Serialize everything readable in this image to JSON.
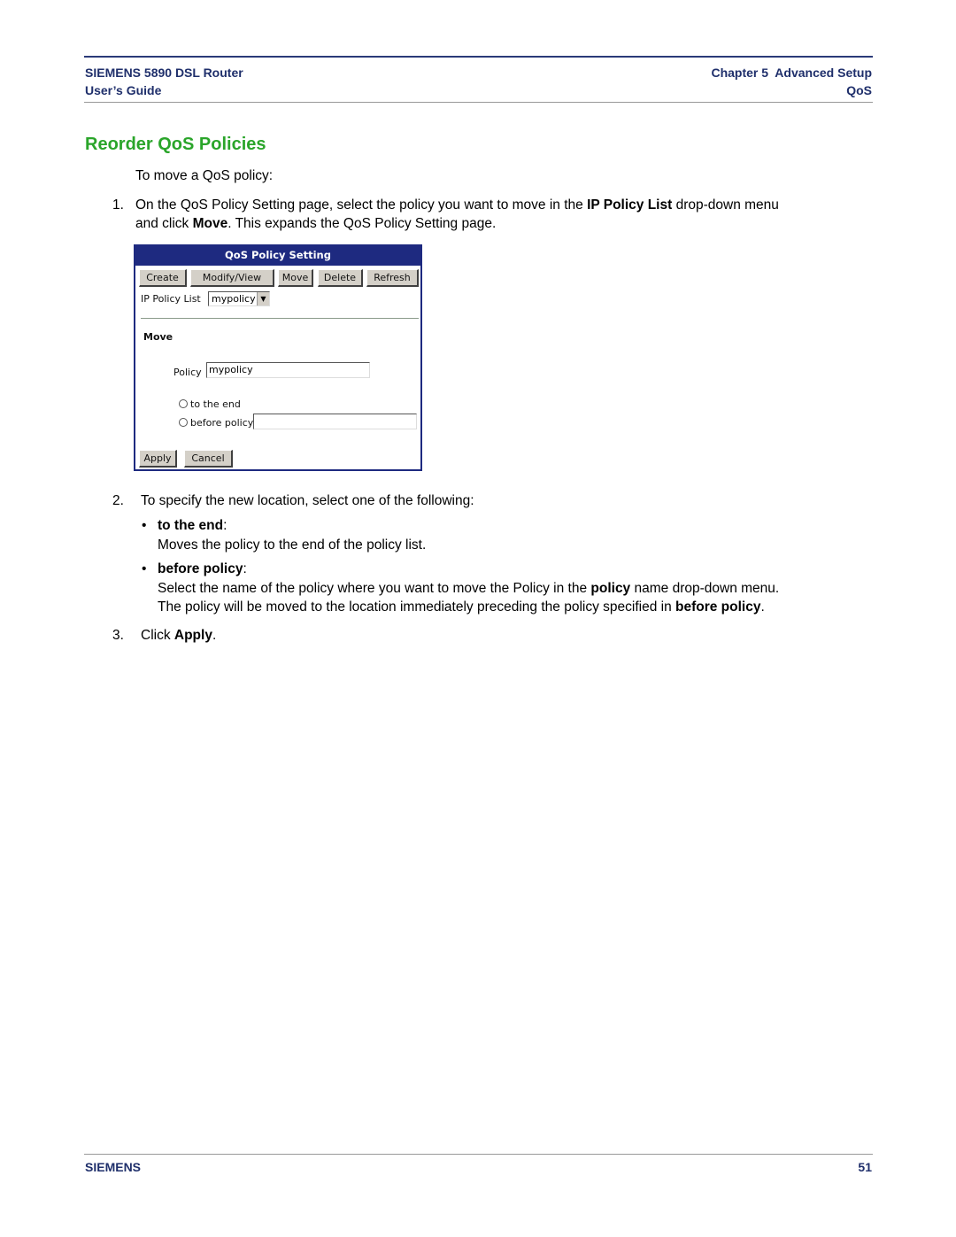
{
  "header": {
    "product": "SIEMENS 5890 DSL Router",
    "guide": "User’s Guide",
    "chapter": "Chapter 5  Advanced Setup",
    "section": "QoS"
  },
  "title": "Reorder QoS Policies",
  "intro": "To move a QoS policy:",
  "steps": [
    {
      "num": "1.",
      "line1": [
        "On the QoS Policy Setting page, select the policy you want to move in the ",
        "IP Policy List",
        " drop-down menu"
      ],
      "line2": [
        "and click ",
        "Move",
        ". This expands the QoS Policy Setting page."
      ]
    },
    {
      "num": "2.",
      "text": "To specify the new location, select one of the following:"
    },
    {
      "num": "3.",
      "text": [
        "Click ",
        "Apply",
        "."
      ]
    }
  ],
  "bullets": [
    {
      "dot": "•",
      "term": "to the end",
      "colon": ":",
      "desc1": "Moves the policy to the end of the policy list."
    },
    {
      "dot": "•",
      "term": "before policy",
      "colon": ":",
      "desc1": [
        "Select the name of the policy where you want to move the Policy in the ",
        "policy",
        " name drop-down menu."
      ],
      "desc2": [
        "The policy will be moved to the location immediately preceding the policy specified in ",
        "before policy",
        "."
      ]
    }
  ],
  "dialog": {
    "title": "QoS Policy Setting",
    "buttons": [
      "Create",
      "Modify/View",
      "Move",
      "Delete",
      "Refresh"
    ],
    "ip_policy_list_label": "IP Policy List",
    "ip_policy_list_value": "mypolicy",
    "move_heading": "Move",
    "policy_label": "Policy",
    "policy_value": "mypolicy",
    "radio_to_end": "to the end",
    "radio_before_policy": "before policy",
    "before_policy_value": "",
    "apply": "Apply",
    "cancel": "Cancel"
  },
  "footer": {
    "brand": "SIEMENS",
    "page": "51"
  },
  "colors": {
    "title_green": "#2aa52a",
    "header_navy": "#1f2f6b",
    "dialog_blue": "#1e2a80"
  }
}
